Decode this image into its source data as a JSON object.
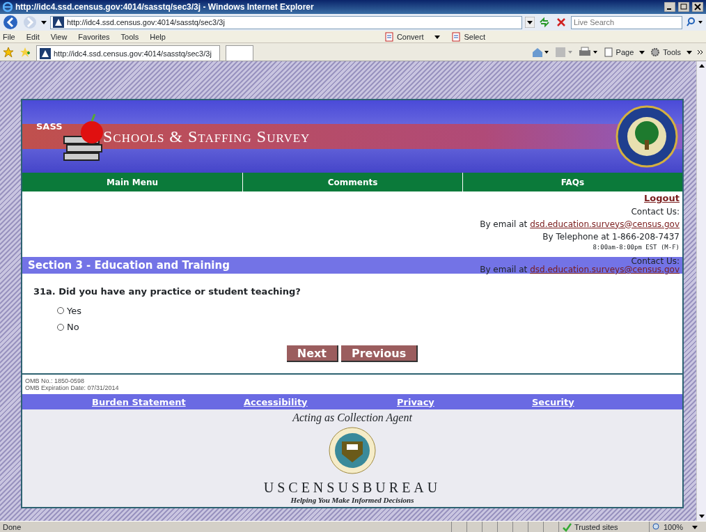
{
  "window": {
    "title": "http://idc4.ssd.census.gov:4014/sasstq/sec3/3j - Windows Internet Explorer"
  },
  "address_bar": {
    "url": "http://idc4.ssd.census.gov:4014/sasstq/sec3/3j",
    "search_placeholder": "Live Search"
  },
  "menu": [
    "File",
    "Edit",
    "View",
    "Favorites",
    "Tools",
    "Help"
  ],
  "menu_commands": [
    "Convert",
    "Select"
  ],
  "tab": {
    "title": "http://idc4.ssd.census.gov:4014/sasstq/sec3/3j"
  },
  "command_bar": [
    "Page",
    "Tools"
  ],
  "banner": {
    "badge": "SASS",
    "title": "Schools & Staffing Survey"
  },
  "nav": [
    "Main Menu",
    "Comments",
    "FAQs"
  ],
  "contact": {
    "logout": "Logout",
    "heading": "Contact Us:",
    "email_prefix": "By email at",
    "email": "dsd.education.surveys@census.gov",
    "phone": "By Telephone at 1-866-208-7437",
    "hours": "8:00am-8:00pm EST (M-F)"
  },
  "section": {
    "title": "Section 3 - Education and Training",
    "contact_heading": "Contact Us:",
    "email_prefix": "By email at",
    "email": "dsd.education.surveys@census.gov"
  },
  "question": {
    "text": "31a. Did you have any practice or student teaching?",
    "options": [
      {
        "label": "Yes",
        "selected": false
      },
      {
        "label": "No",
        "selected": false
      }
    ]
  },
  "buttons": [
    "Next",
    "Previous"
  ],
  "omb": [
    "OMB No.: 1850-0598",
    "OMB Expiration Date: 07/31/2014"
  ],
  "footer_links": [
    "Burden Statement",
    "Accessibility",
    "Privacy",
    "Security"
  ],
  "footer": {
    "agent": "Acting as Collection Agent",
    "bureau": "USCENSUSBUREAU",
    "tagline": "Helping You Make Informed Decisions"
  },
  "status_bar": {
    "text": "Done",
    "zone": "Trusted sites",
    "zoom": "100%"
  }
}
